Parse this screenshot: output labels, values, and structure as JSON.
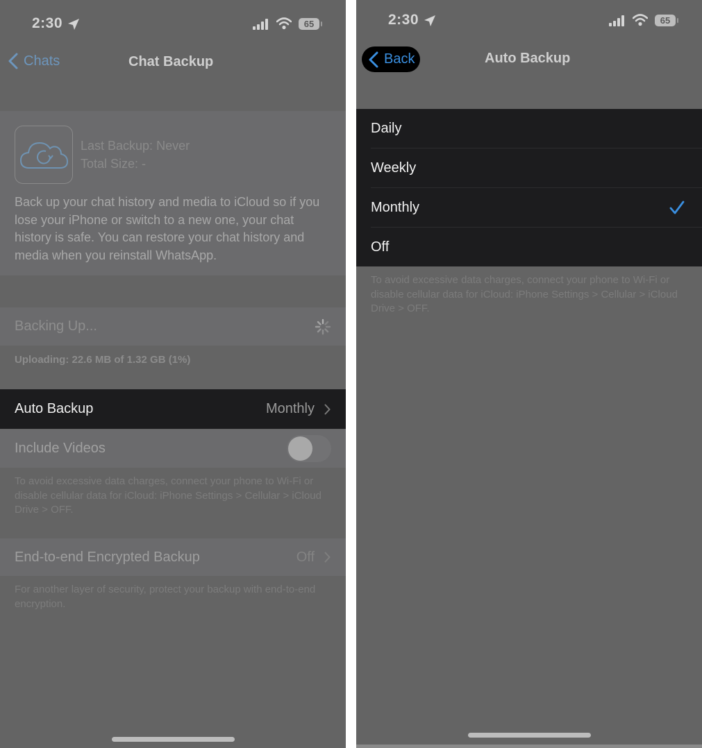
{
  "left_screen": {
    "status_bar": {
      "time": "2:30",
      "battery": "65",
      "location_icon": "location-arrow-icon",
      "signal_icon": "cellular-signal-icon",
      "wifi_icon": "wifi-icon"
    },
    "nav": {
      "back_label": "Chats",
      "title": "Chat Backup"
    },
    "backup_info": {
      "icon": "icloud-backup-icon",
      "last_backup": "Last Backup: Never",
      "total_size": "Total Size: -",
      "description": "Back up your chat history and media to iCloud so if you lose your iPhone or switch to a new one, your chat history is safe. You can restore your chat history and media when you reinstall WhatsApp."
    },
    "backing_up": {
      "label": "Backing Up...",
      "spinner_icon": "activity-spinner-icon"
    },
    "upload_status": "Uploading: 22.6 MB of 1.32 GB (1%)",
    "upload_progress_percent": 1,
    "auto_backup": {
      "label": "Auto Backup",
      "value": "Monthly"
    },
    "include_videos": {
      "label": "Include Videos",
      "enabled": false
    },
    "data_note": "To avoid excessive data charges, connect your phone to Wi-Fi or disable cellular data for iCloud: iPhone Settings > Cellular > iCloud Drive > OFF.",
    "e2e_backup": {
      "label": "End-to-end Encrypted Backup",
      "value": "Off"
    },
    "e2e_note": "For another layer of security, protect your backup with end-to-end encryption."
  },
  "right_screen": {
    "status_bar": {
      "time": "2:30",
      "battery": "65"
    },
    "nav": {
      "back_label": "Back",
      "title": "Auto Backup"
    },
    "options": [
      {
        "label": "Daily",
        "selected": false
      },
      {
        "label": "Weekly",
        "selected": false
      },
      {
        "label": "Monthly",
        "selected": true
      },
      {
        "label": "Off",
        "selected": false
      }
    ],
    "data_note": "To avoid excessive data charges, connect your phone to Wi-Fi or disable cellular data for iCloud: iPhone Settings > Cellular > iCloud Drive > OFF."
  },
  "colors": {
    "accent_blue": "#3a8fe0",
    "dim_blue": "#6d96bd",
    "highlight_bg": "#1c1c1e",
    "overlay_bg": "#646464"
  }
}
